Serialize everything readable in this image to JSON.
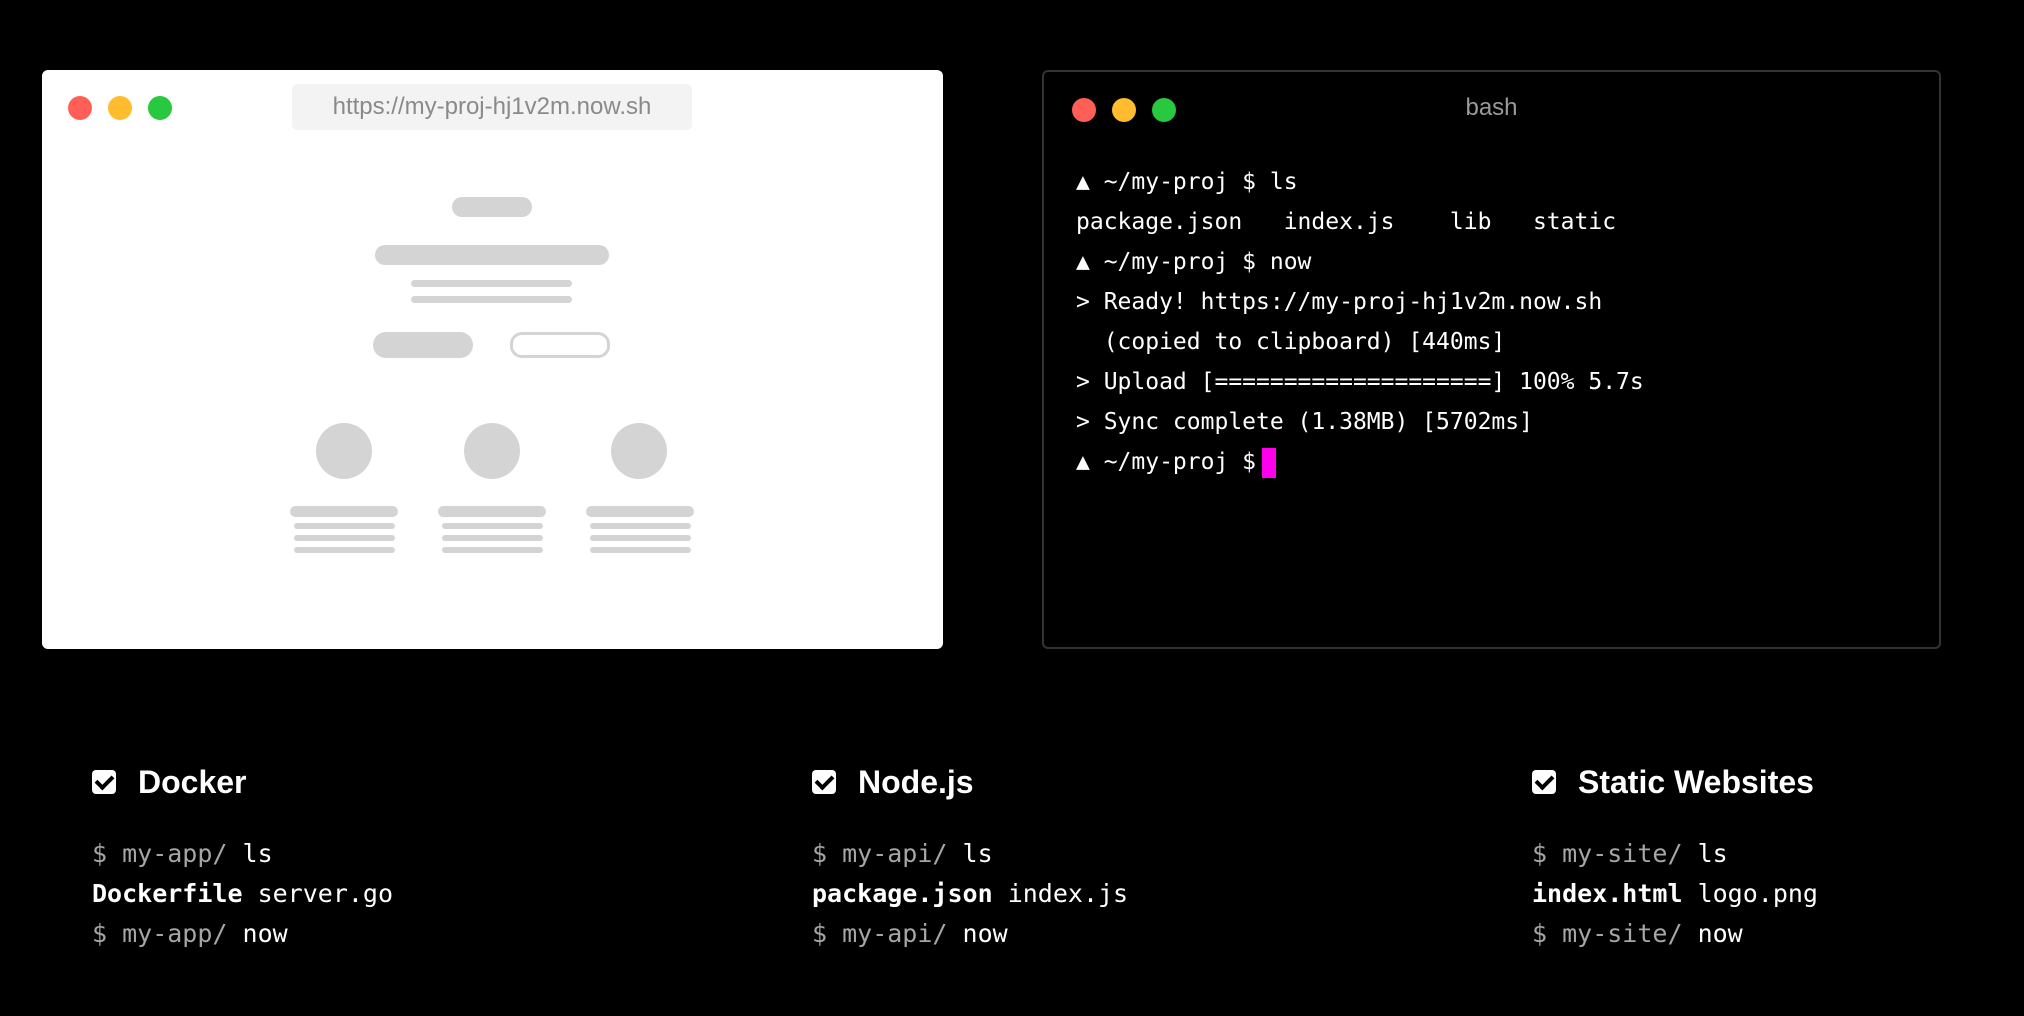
{
  "browser": {
    "url": "https://my-proj-hj1v2m.now.sh"
  },
  "terminal": {
    "title": "bash",
    "lines": [
      "▲ ~/my-proj $ ls",
      "package.json   index.js    lib   static",
      "▲ ~/my-proj $ now",
      "> Ready! https://my-proj-hj1v2m.now.sh",
      "  (copied to clipboard) [440ms]",
      "> Upload [====================] 100% 5.7s",
      "> Sync complete (1.38MB) [5702ms]"
    ],
    "prompt": "▲ ~/my-proj $",
    "cursor_color": "#ff00ea"
  },
  "features": [
    {
      "title": "Docker",
      "prompt": "$ my-app/",
      "cmd1": "ls",
      "file_bold": "Dockerfile",
      "file_other": "server.go",
      "cmd2": "now"
    },
    {
      "title": "Node.js",
      "prompt": "$ my-api/",
      "cmd1": "ls",
      "file_bold": "package.json",
      "file_other": "index.js",
      "cmd2": "now"
    },
    {
      "title": "Static Websites",
      "prompt": "$ my-site/",
      "cmd1": "ls",
      "file_bold": "index.html",
      "file_other": "logo.png",
      "cmd2": "now"
    }
  ],
  "icons": [
    "close-dot",
    "minimize-dot",
    "maximize-dot",
    "checkbox-checked-icon"
  ],
  "colors": {
    "red": "#ff5f57",
    "yellow": "#febc2e",
    "green": "#28c840"
  }
}
